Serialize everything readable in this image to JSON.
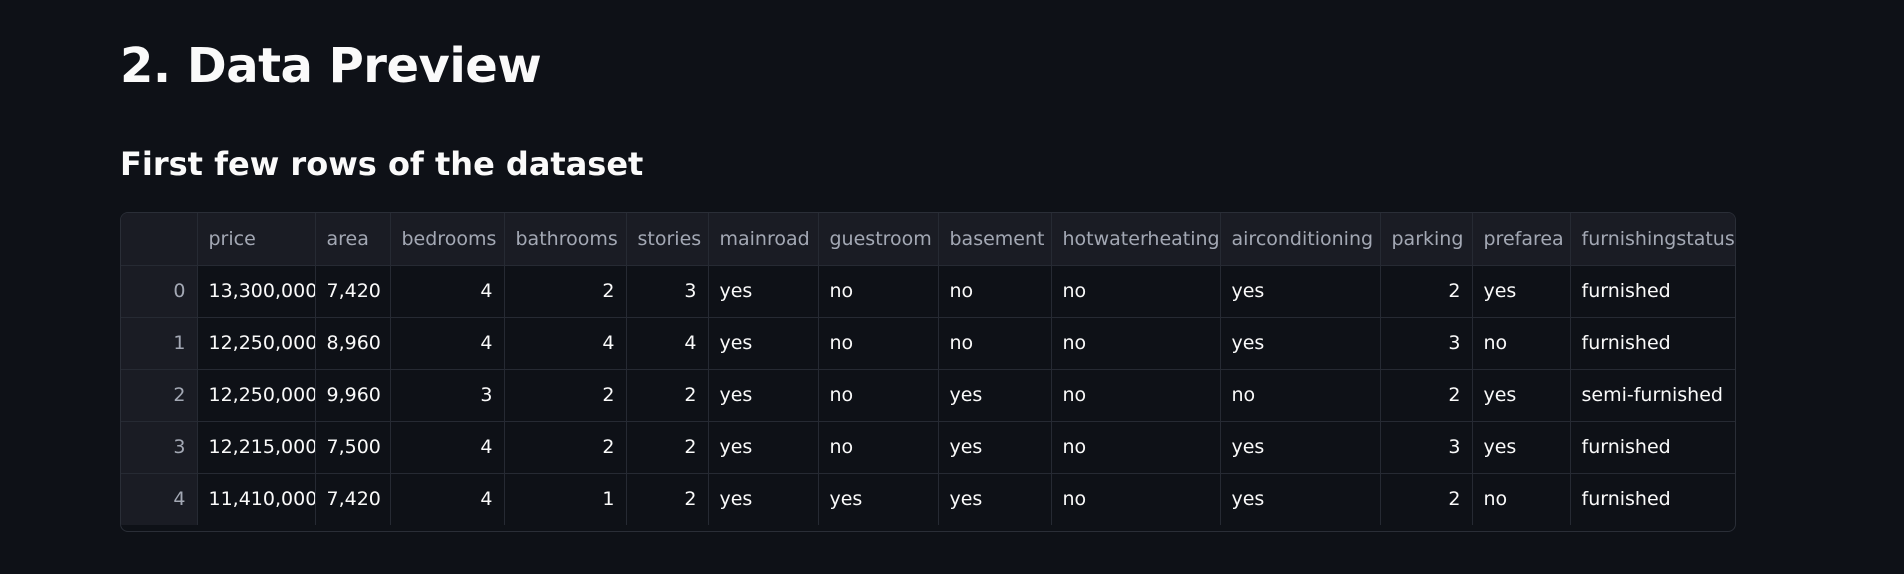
{
  "page": {
    "title": "2. Data Preview",
    "subtitle": "First few rows of the dataset"
  },
  "table": {
    "columns": [
      "",
      "price",
      "area",
      "bedrooms",
      "bathrooms",
      "stories",
      "mainroad",
      "guestroom",
      "basement",
      "hotwaterheating",
      "airconditioning",
      "parking",
      "prefarea",
      "furnishingstatus"
    ],
    "rows": [
      [
        "0",
        "13,300,000",
        "7,420",
        "4",
        "2",
        "3",
        "yes",
        "no",
        "no",
        "no",
        "yes",
        "2",
        "yes",
        "furnished"
      ],
      [
        "1",
        "12,250,000",
        "8,960",
        "4",
        "4",
        "4",
        "yes",
        "no",
        "no",
        "no",
        "yes",
        "3",
        "no",
        "furnished"
      ],
      [
        "2",
        "12,250,000",
        "9,960",
        "3",
        "2",
        "2",
        "yes",
        "no",
        "yes",
        "no",
        "no",
        "2",
        "yes",
        "semi-furnished"
      ],
      [
        "3",
        "12,215,000",
        "7,500",
        "4",
        "2",
        "2",
        "yes",
        "no",
        "yes",
        "no",
        "yes",
        "3",
        "yes",
        "furnished"
      ],
      [
        "4",
        "11,410,000",
        "7,420",
        "4",
        "1",
        "2",
        "yes",
        "yes",
        "yes",
        "no",
        "yes",
        "2",
        "no",
        "furnished"
      ]
    ]
  },
  "colors": {
    "background": "#0e1117",
    "header_background": "#1a1c24",
    "header_text": "#a3a8b4",
    "cell_text": "#fafafa",
    "grid_line": "#262a33"
  }
}
